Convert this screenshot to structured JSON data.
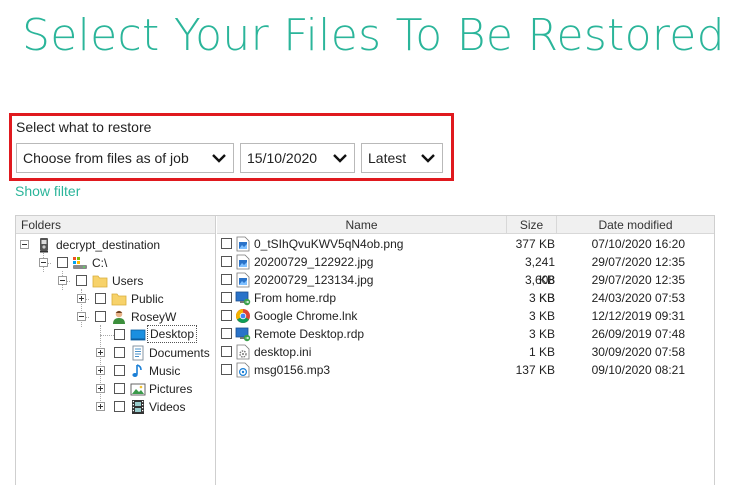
{
  "title": "Select Your Files To Be Restored",
  "restore": {
    "label": "Select what to restore",
    "type_value": "Choose from files as of job",
    "date_value": "15/10/2020",
    "version_value": "Latest"
  },
  "show_filter": "Show filter",
  "folders_header": "Folders",
  "columns": {
    "name": "Name",
    "size": "Size",
    "date": "Date modified"
  },
  "tree": {
    "root": "decrypt_destination",
    "drive": "C:\\",
    "users": "Users",
    "public": "Public",
    "user": "RoseyW",
    "desktop": "Desktop",
    "documents": "Documents",
    "music": "Music",
    "pictures": "Pictures",
    "videos": "Videos"
  },
  "files": [
    {
      "name": "0_tSIhQvuKWV5qN4ob.png",
      "size": "377 KB",
      "date": "07/10/2020 16:20",
      "icon": "image-file-icon"
    },
    {
      "name": "20200729_122922.jpg",
      "size": "3,241 KB",
      "date": "29/07/2020 12:35",
      "icon": "image-file-icon"
    },
    {
      "name": "20200729_123134.jpg",
      "size": "3,608 KB",
      "date": "29/07/2020 12:35",
      "icon": "image-file-icon"
    },
    {
      "name": "From home.rdp",
      "size": "3 KB",
      "date": "24/03/2020 07:53",
      "icon": "remote-desktop-icon"
    },
    {
      "name": "Google Chrome.lnk",
      "size": "3 KB",
      "date": "12/12/2019 09:31",
      "icon": "chrome-icon"
    },
    {
      "name": "Remote Desktop.rdp",
      "size": "3 KB",
      "date": "26/09/2019 07:48",
      "icon": "remote-desktop-icon"
    },
    {
      "name": "desktop.ini",
      "size": "1 KB",
      "date": "30/09/2020 07:58",
      "icon": "settings-file-icon"
    },
    {
      "name": "msg0156.mp3",
      "size": "137 KB",
      "date": "09/10/2020 08:21",
      "icon": "audio-file-icon"
    }
  ],
  "colors": {
    "accent": "#2bb59a",
    "highlight_border": "#e0191e"
  }
}
